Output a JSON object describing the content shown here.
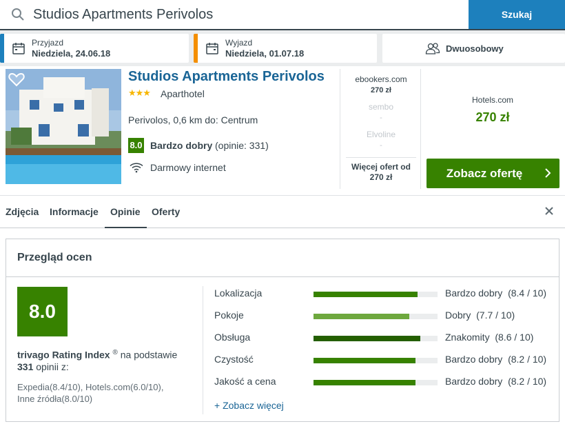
{
  "search": {
    "query": "Studios Apartments Perivolos",
    "button_label": "Szukaj"
  },
  "dates": {
    "checkin_label": "Przyjazd",
    "checkin_value": "Niedziela, 24.06.18",
    "checkout_label": "Wyjazd",
    "checkout_value": "Niedziela, 01.07.18",
    "room_label": "Dwuosobowy"
  },
  "hotel": {
    "name": "Studios Apartments Perivolos",
    "stars": "★★★",
    "type": "Aparthotel",
    "location": "Perivolos, 0,6 km do: Centrum",
    "rating": "8.0",
    "rating_word": "Bardzo dobry",
    "rating_count": "(opinie: 331)",
    "amenity": "Darmowy internet"
  },
  "offers": [
    {
      "site": "ebookers.com",
      "price": "270 zł"
    },
    {
      "site": "sembo",
      "price": "-"
    },
    {
      "site": "Elvoline",
      "price": "-"
    }
  ],
  "more_offers": {
    "line1": "Więcej ofert od",
    "line2": "270 zł"
  },
  "best_deal": {
    "site": "Hotels.com",
    "price": "270 zł",
    "button_label": "Zobacz ofertę"
  },
  "tabs": [
    {
      "label": "Zdjęcia"
    },
    {
      "label": "Informacje"
    },
    {
      "label": "Opinie"
    },
    {
      "label": "Oferty"
    }
  ],
  "reviews": {
    "title": "Przegląd ocen",
    "score": "8.0",
    "index_name": "trivago Rating Index",
    "index_reg": "®",
    "index_suffix": " na podstawie",
    "index_count": "331",
    "index_count_suffix": " opinii z:",
    "sources_line1": "Expedia(8.4/10), Hotels.com(6.0/10),",
    "sources_line2": "Inne źródła(8.0/10)",
    "categories": [
      {
        "name": "Lokalizacja",
        "word": "Bardzo dobry",
        "score": "(8.4 / 10)",
        "value": 8.4,
        "color": "#378200"
      },
      {
        "name": "Pokoje",
        "word": "Dobry",
        "score": "(7.7 / 10)",
        "value": 7.7,
        "color": "#6ea83e"
      },
      {
        "name": "Obsługa",
        "word": "Znakomity",
        "score": "(8.6 / 10)",
        "value": 8.6,
        "color": "#245f00"
      },
      {
        "name": "Czystość",
        "word": "Bardzo dobry",
        "score": "(8.2 / 10)",
        "value": 8.2,
        "color": "#378200"
      },
      {
        "name": "Jakość a cena",
        "word": "Bardzo dobry",
        "score": "(8.2 / 10)",
        "value": 8.2,
        "color": "#378200"
      }
    ],
    "see_more": "+ Zobacz więcej"
  }
}
